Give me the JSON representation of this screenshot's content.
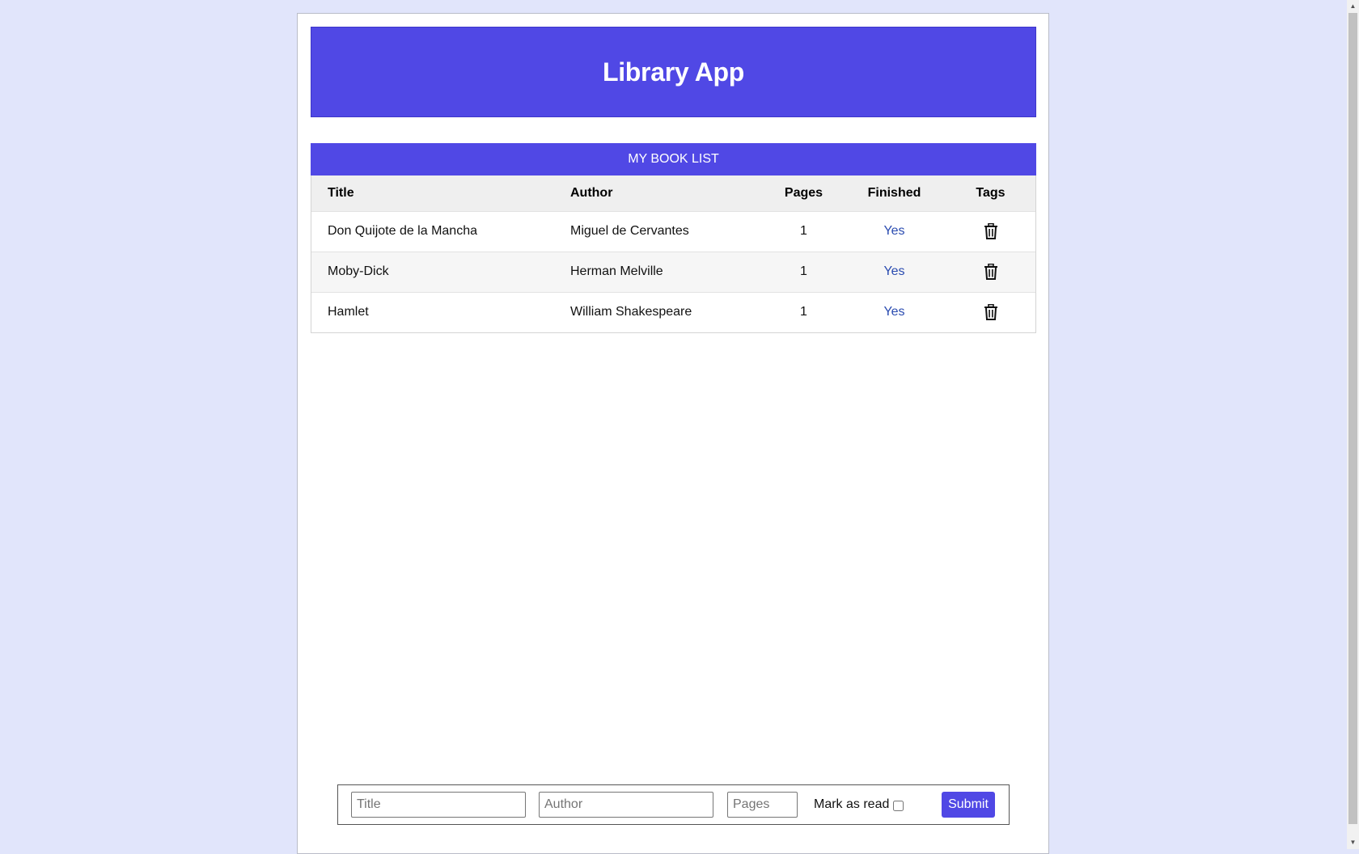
{
  "app": {
    "title": "Library App"
  },
  "book_list": {
    "caption": "MY BOOK LIST",
    "columns": [
      "Title",
      "Author",
      "Pages",
      "Finished",
      "Tags"
    ],
    "rows": [
      {
        "title": "Don Quijote de la Mancha",
        "author": "Miguel de Cervantes",
        "pages": "1",
        "finished": "Yes",
        "tag_icon": "trash-icon"
      },
      {
        "title": "Moby-Dick",
        "author": "Herman Melville",
        "pages": "1",
        "finished": "Yes",
        "tag_icon": "trash-icon"
      },
      {
        "title": "Hamlet",
        "author": "William Shakespeare",
        "pages": "1",
        "finished": "Yes",
        "tag_icon": "trash-icon"
      }
    ]
  },
  "form": {
    "title_placeholder": "Title",
    "title_value": "",
    "author_placeholder": "Author",
    "author_value": "",
    "pages_placeholder": "Pages",
    "pages_value": "",
    "mark_label": "Mark as read",
    "mark_checked": false,
    "submit_label": "Submit"
  },
  "colors": {
    "accent": "#5048e5",
    "background": "#e1e5fb",
    "link": "#2a4bb0"
  }
}
